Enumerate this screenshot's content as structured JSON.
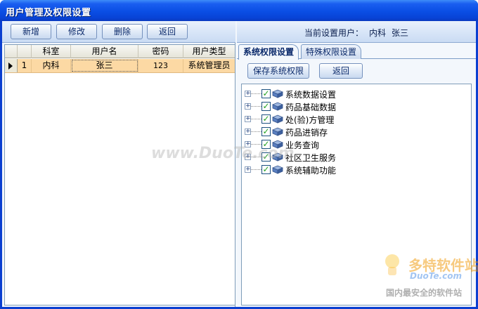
{
  "window": {
    "title": "用户管理及权限设置"
  },
  "toolbar": {
    "add_label": "新增",
    "edit_label": "修改",
    "delete_label": "删除",
    "back_label": "返回"
  },
  "grid": {
    "columns": [
      "科室",
      "用户名",
      "密码",
      "用户类型"
    ],
    "rows": [
      {
        "index": "1",
        "dept": "内科",
        "username": "张三",
        "password": "123",
        "type": "系统管理员"
      }
    ]
  },
  "right": {
    "current_user_label": "当前设置用户：",
    "current_user_dept": "内科",
    "current_user_name": "张三",
    "tabs": [
      {
        "label": "系统权限设置",
        "active": true
      },
      {
        "label": "特殊权限设置",
        "active": false
      }
    ],
    "save_label": "保存系统权限",
    "back_label": "返回",
    "tree": [
      {
        "label": "系统数据设置",
        "checked": true
      },
      {
        "label": "药品基础数据",
        "checked": true
      },
      {
        "label": "处(验)方管理",
        "checked": true
      },
      {
        "label": "药品进销存",
        "checked": true
      },
      {
        "label": "业务查询",
        "checked": true
      },
      {
        "label": "社区卫生服务",
        "checked": true
      },
      {
        "label": "系统辅助功能",
        "checked": true
      }
    ]
  },
  "watermark": {
    "center": "www.DuoTe.com",
    "brand": "多特软件站",
    "brand_url": "DuoTe.com",
    "slogan": "国内最安全的软件站"
  },
  "colors": {
    "title_blue": "#0a4ee4",
    "row_selected": "#fcd9a4",
    "check_green": "#21a121"
  }
}
